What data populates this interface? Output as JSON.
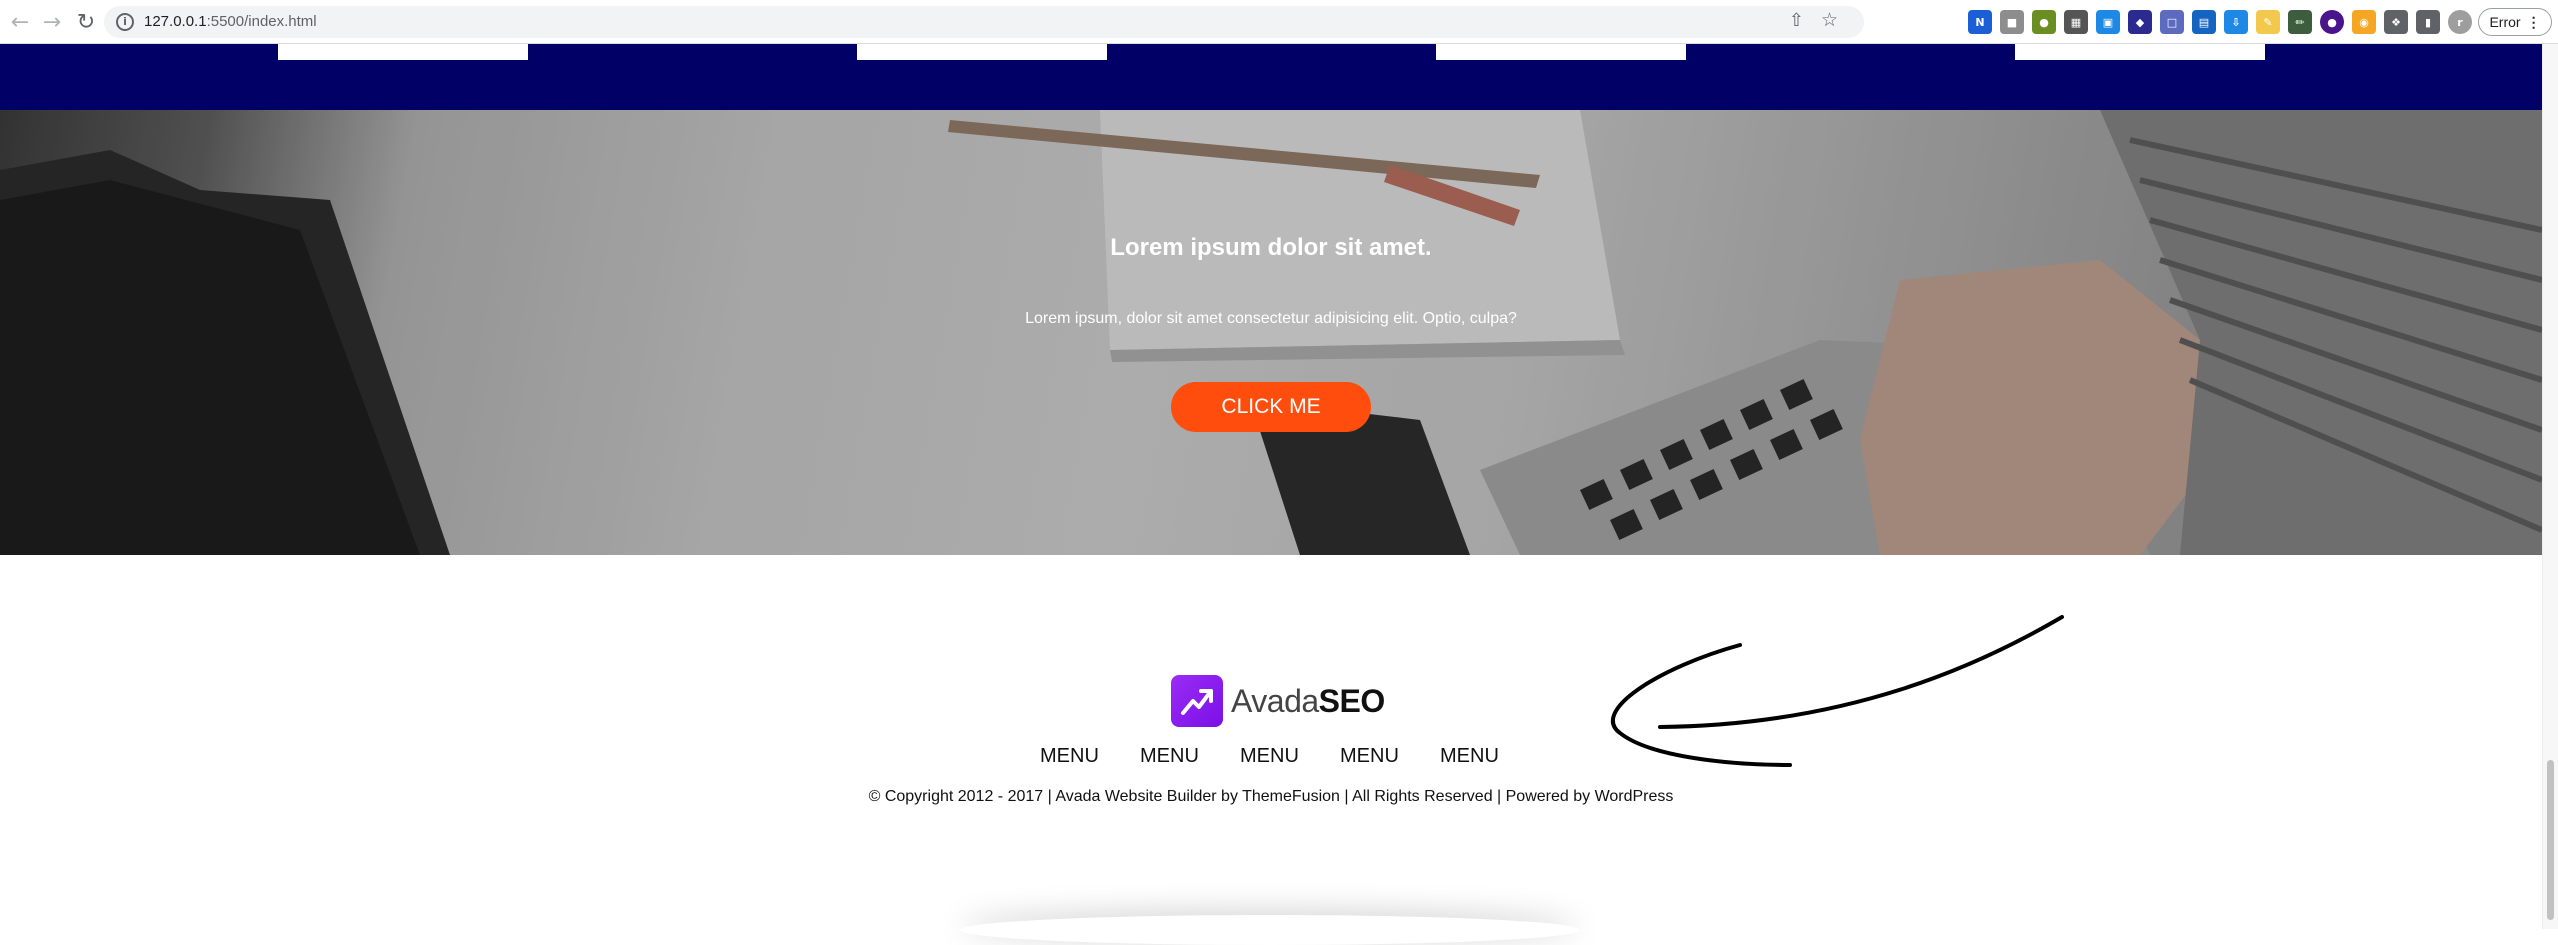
{
  "browser": {
    "url_host": "127.0.0.1",
    "url_rest": ":5500/index.html",
    "error_label": "Error",
    "profile_letter": "r"
  },
  "hero": {
    "title": "Lorem ipsum dolor sit amet.",
    "text": "Lorem ipsum, dolor sit amet consectetur adipisicing elit. Optio, culpa?",
    "button_label": "CLICK ME",
    "button_color": "#ff4d0d"
  },
  "footer": {
    "logo_text_regular": "Avada",
    "logo_text_bold": "SEO",
    "menu": [
      "MENU",
      "MENU",
      "MENU",
      "MENU",
      "MENU"
    ],
    "copyright": "© Copyright 2012 - 2017 | Avada Website Builder by ThemeFusion | All Rights Reserved | Powered by WordPress"
  },
  "colors": {
    "navy": "#000066",
    "logo_purple": "#8a1cf0"
  },
  "icons": {
    "back": "arrow-left-icon",
    "forward": "arrow-right-icon",
    "reload": "reload-icon",
    "info": "info-icon",
    "share": "share-icon",
    "bookmark": "star-icon"
  }
}
